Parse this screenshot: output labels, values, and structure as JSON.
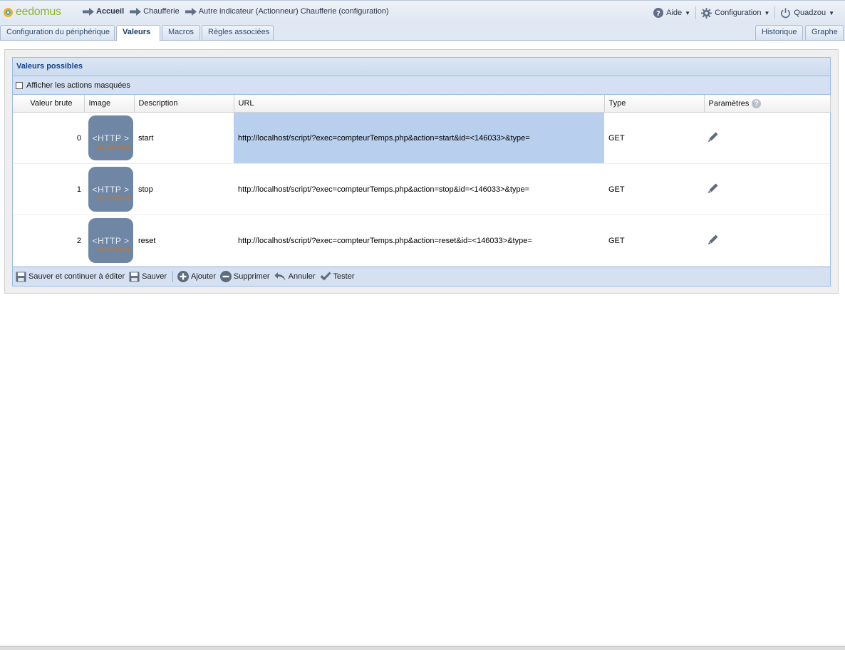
{
  "header": {
    "logo_text": "eedomus",
    "breadcrumbs": [
      "Accueil",
      "Chaufferie",
      "Autre indicateur (Actionneur) Chaufferie (configuration)"
    ],
    "menu": {
      "help": "Aide",
      "config": "Configuration",
      "user": "Quadzou"
    }
  },
  "tabs": {
    "left": [
      "Configuration du périphérique",
      "Valeurs",
      "Macros",
      "Règles associées"
    ],
    "right": [
      "Historique",
      "Graphe"
    ],
    "active": "Valeurs"
  },
  "panel": {
    "title": "Valeurs possibles",
    "show_hidden_label": "Afficher les actions masquées",
    "columns": [
      "Valeur brute",
      "Image",
      "Description",
      "URL",
      "Type",
      "Paramètres"
    ],
    "image_text": {
      "line1": "<HTTP >",
      "line2": "actionneur"
    },
    "rows": [
      {
        "value": "0",
        "description": "start",
        "url": "http://localhost/script/?exec=compteurTemps.php&action=start&id=<146033>&type=",
        "type": "GET"
      },
      {
        "value": "1",
        "description": "stop",
        "url": "http://localhost/script/?exec=compteurTemps.php&action=stop&id=<146033>&type=",
        "type": "GET"
      },
      {
        "value": "2",
        "description": "reset",
        "url": "http://localhost/script/?exec=compteurTemps.php&action=reset&id=<146033>&type=",
        "type": "GET"
      }
    ],
    "toolbar": {
      "save_continue": "Sauver et continuer à éditer",
      "save": "Sauver",
      "add": "Ajouter",
      "delete": "Supprimer",
      "cancel": "Annuler",
      "test": "Tester"
    }
  },
  "colors": {
    "accent": "#15428b",
    "selection": "#b8cfee",
    "panel_border": "#99bbe8"
  }
}
